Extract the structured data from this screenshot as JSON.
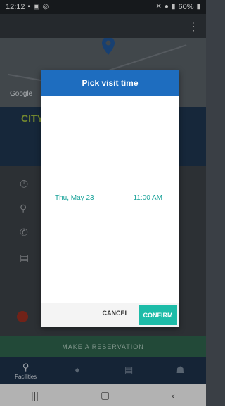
{
  "status_bar": {
    "time": "12:12",
    "battery": "60%"
  },
  "dialog": {
    "title": "Pick visit time",
    "date": "Thu, May 23",
    "time": "11:00 AM",
    "cancel_label": "CANCEL",
    "confirm_label": "CONFIRM"
  },
  "map": {
    "google_label": "Google"
  },
  "banner": {
    "logo_text": "CITY HAR"
  },
  "reservation": {
    "button_label": "MAKE A RESERVATION"
  },
  "bottom_nav": {
    "items": [
      {
        "label": "Facilities",
        "icon": "location-pin-icon"
      },
      {
        "label": "",
        "icon": "drop-icon"
      },
      {
        "label": "",
        "icon": "message-icon"
      },
      {
        "label": "",
        "icon": "profile-icon"
      }
    ]
  },
  "colors": {
    "dialog_header": "#1e6dbf",
    "accent_teal": "#1dbca8",
    "picker_text": "#1aa39a"
  }
}
